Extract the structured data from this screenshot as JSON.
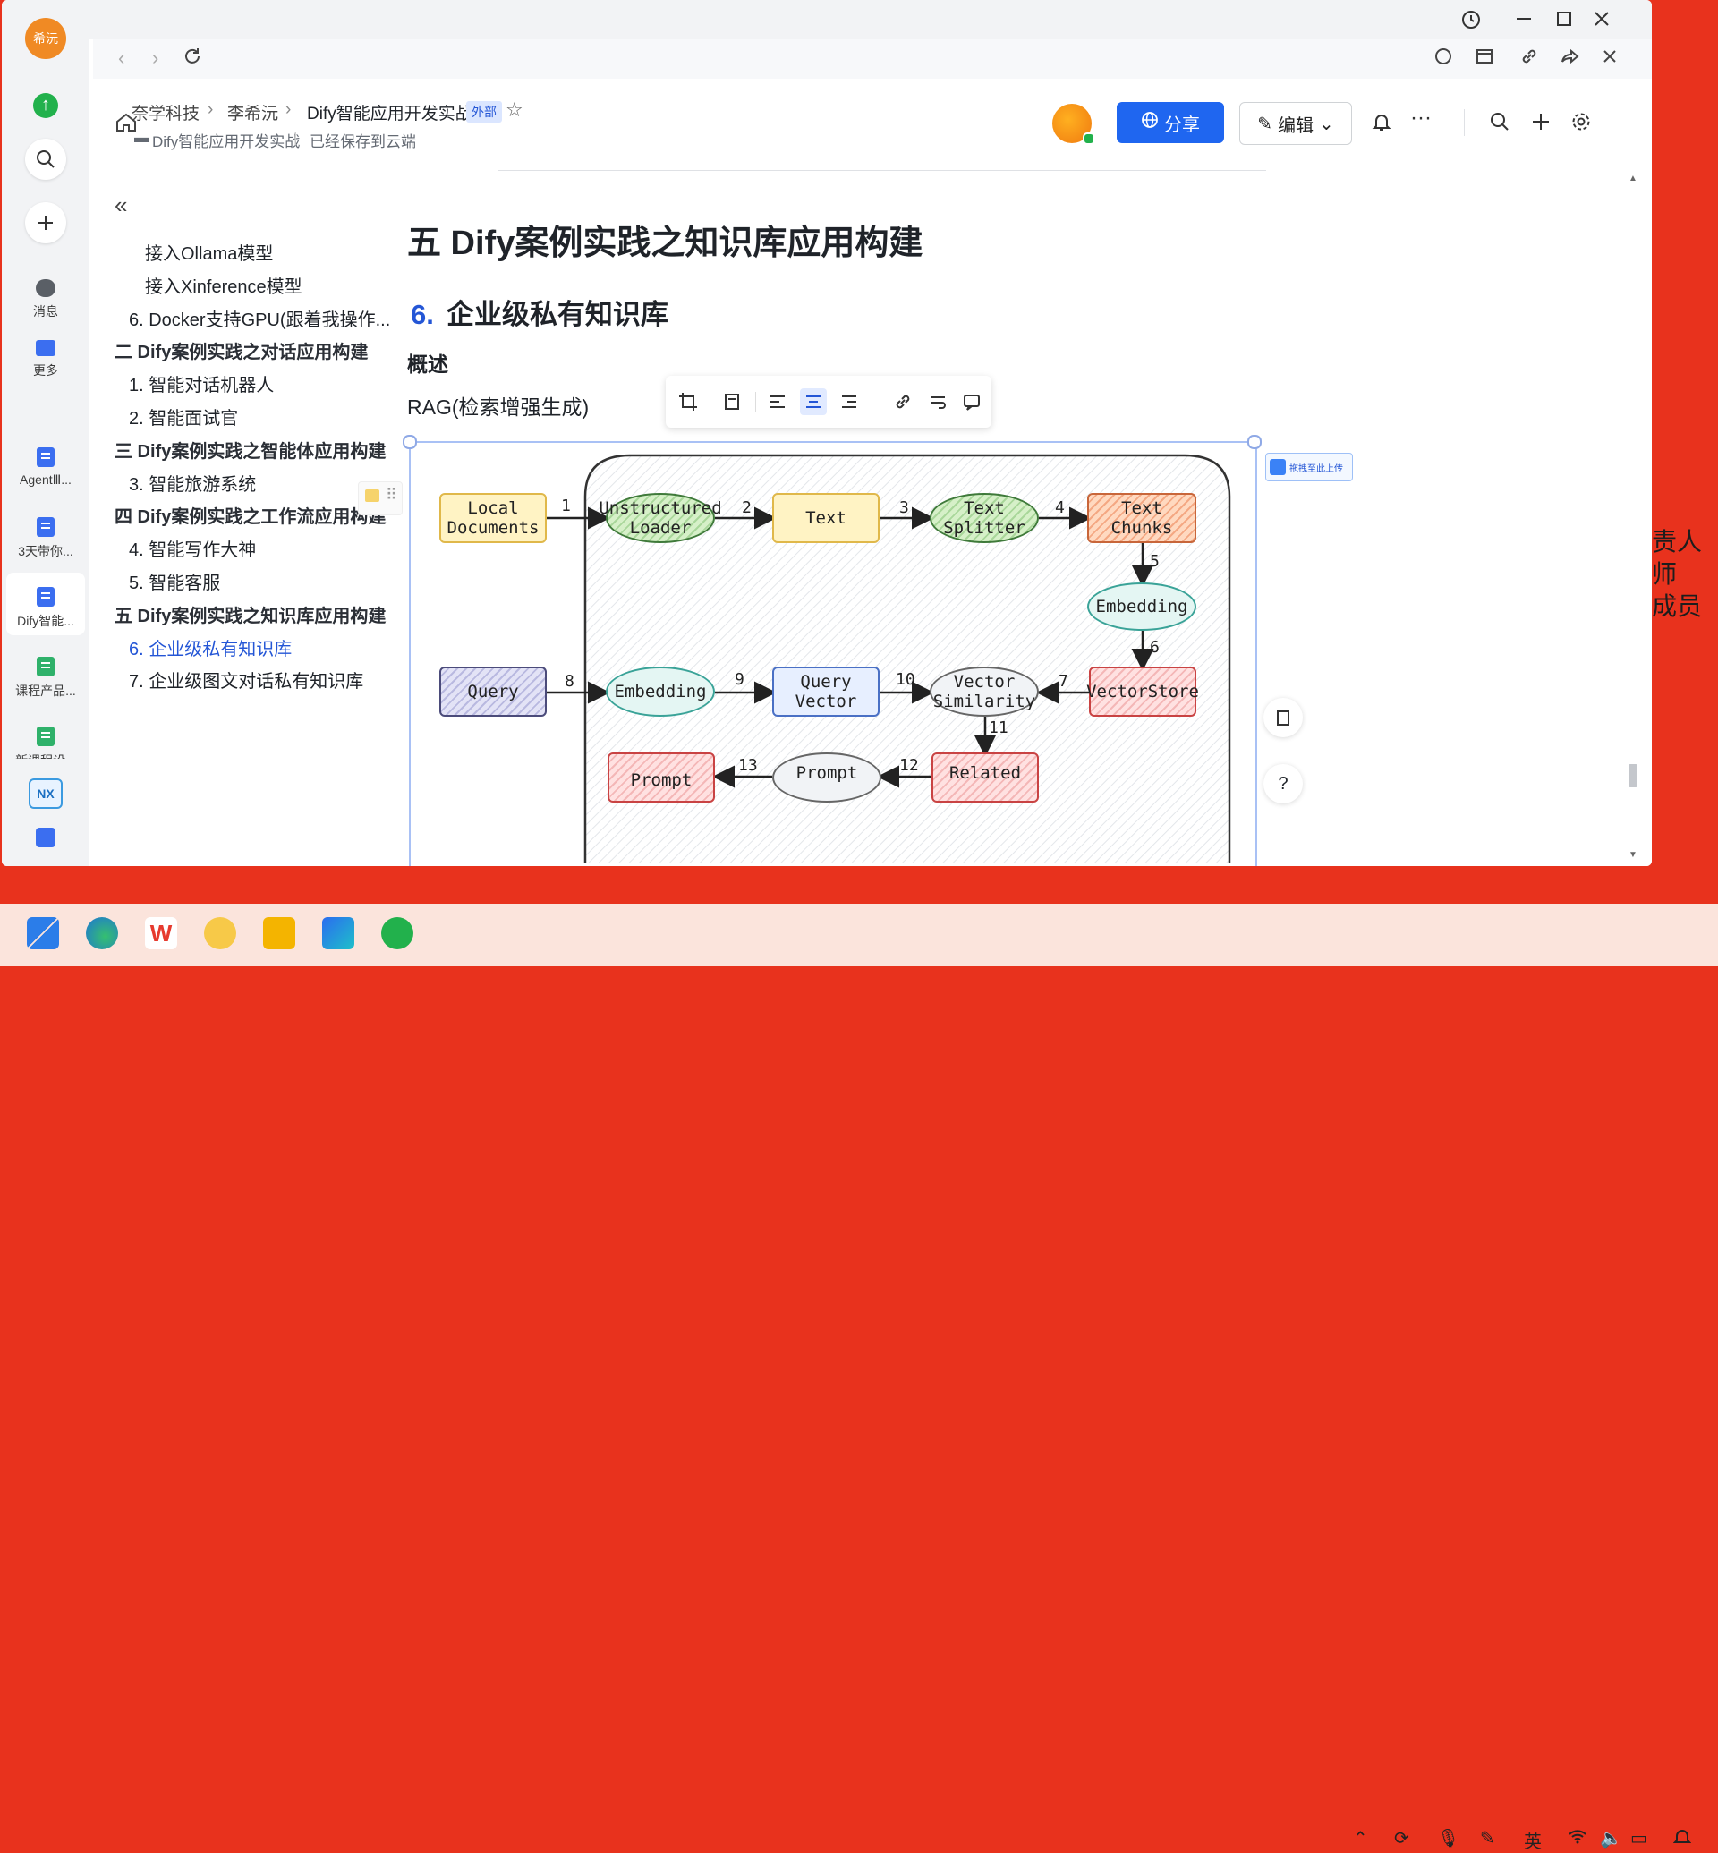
{
  "window": {
    "title_icons": [
      "history-icon",
      "minimize-icon",
      "maximize-icon",
      "close-icon"
    ]
  },
  "rail": {
    "avatar_text": "希沅",
    "items": [
      {
        "label": "消息"
      },
      {
        "label": "更多"
      },
      {
        "label": "AgentⅢ..."
      },
      {
        "label": "3天带你..."
      },
      {
        "label": "Dify智能..."
      },
      {
        "label": "课程产品..."
      },
      {
        "label": "新课程设..."
      },
      {
        "label": "NX"
      }
    ]
  },
  "breadcrumb": {
    "items": [
      "奈学科技",
      "李希沅",
      "Dify智能应用开发实战"
    ],
    "badge": "外部",
    "folder": "Dify智能应用开发实战",
    "status": "已经保存到云端"
  },
  "header": {
    "share_label": "分享",
    "edit_label": "编辑"
  },
  "outline": [
    {
      "text": "接入Ollama模型",
      "level": 3
    },
    {
      "text": "接入Xinference模型",
      "level": 3
    },
    {
      "text": "6. Docker支持GPU(跟着我操作...",
      "level": 2
    },
    {
      "text": "二 Dify案例实践之对话应用构建",
      "level": 1
    },
    {
      "text": "1. 智能对话机器人",
      "level": 2
    },
    {
      "text": "2. 智能面试官",
      "level": 2
    },
    {
      "text": "三 Dify案例实践之智能体应用构建",
      "level": 1
    },
    {
      "text": "3. 智能旅游系统",
      "level": 2
    },
    {
      "text": "四 Dify案例实践之工作流应用构建",
      "level": 1
    },
    {
      "text": "4. 智能写作大神",
      "level": 2
    },
    {
      "text": "5. 智能客服",
      "level": 2
    },
    {
      "text": "五 Dify案例实践之知识库应用构建",
      "level": 1
    },
    {
      "text": "6. 企业级私有知识库",
      "level": 2,
      "active": true
    },
    {
      "text": "7. 企业级图文对话私有知识库",
      "level": 2
    }
  ],
  "content": {
    "h1": "五  Dify案例实践之知识库应用构建",
    "h2_num": "6.",
    "h2_text": "企业级私有知识库",
    "h3": "概述",
    "para": "RAG(检索增强生成)"
  },
  "upload_hint": "拖拽至此上传",
  "diagram": {
    "nodes": {
      "local_documents": "Local\nDocuments",
      "unstructured_loader": "Unstructured\nLoader",
      "text": "Text",
      "text_splitter": "Text\nSplitter",
      "text_chunks": "Text\nChunks",
      "embedding_top": "Embedding",
      "vectorstore": "VectorStore",
      "query": "Query",
      "embedding_bottom": "Embedding",
      "query_vector": "Query\nVector",
      "vector_similarity": "Vector\nSimilarity",
      "related": "Related",
      "prompt_ellipse": "Prompt",
      "prompt_rect": "Prompt"
    },
    "edge_labels": [
      "1",
      "2",
      "3",
      "4",
      "5",
      "6",
      "7",
      "8",
      "9",
      "10",
      "11",
      "12",
      "13"
    ]
  },
  "background_text": [
    "责人",
    "师",
    "成员"
  ],
  "taskbar": {
    "ime": "英"
  }
}
